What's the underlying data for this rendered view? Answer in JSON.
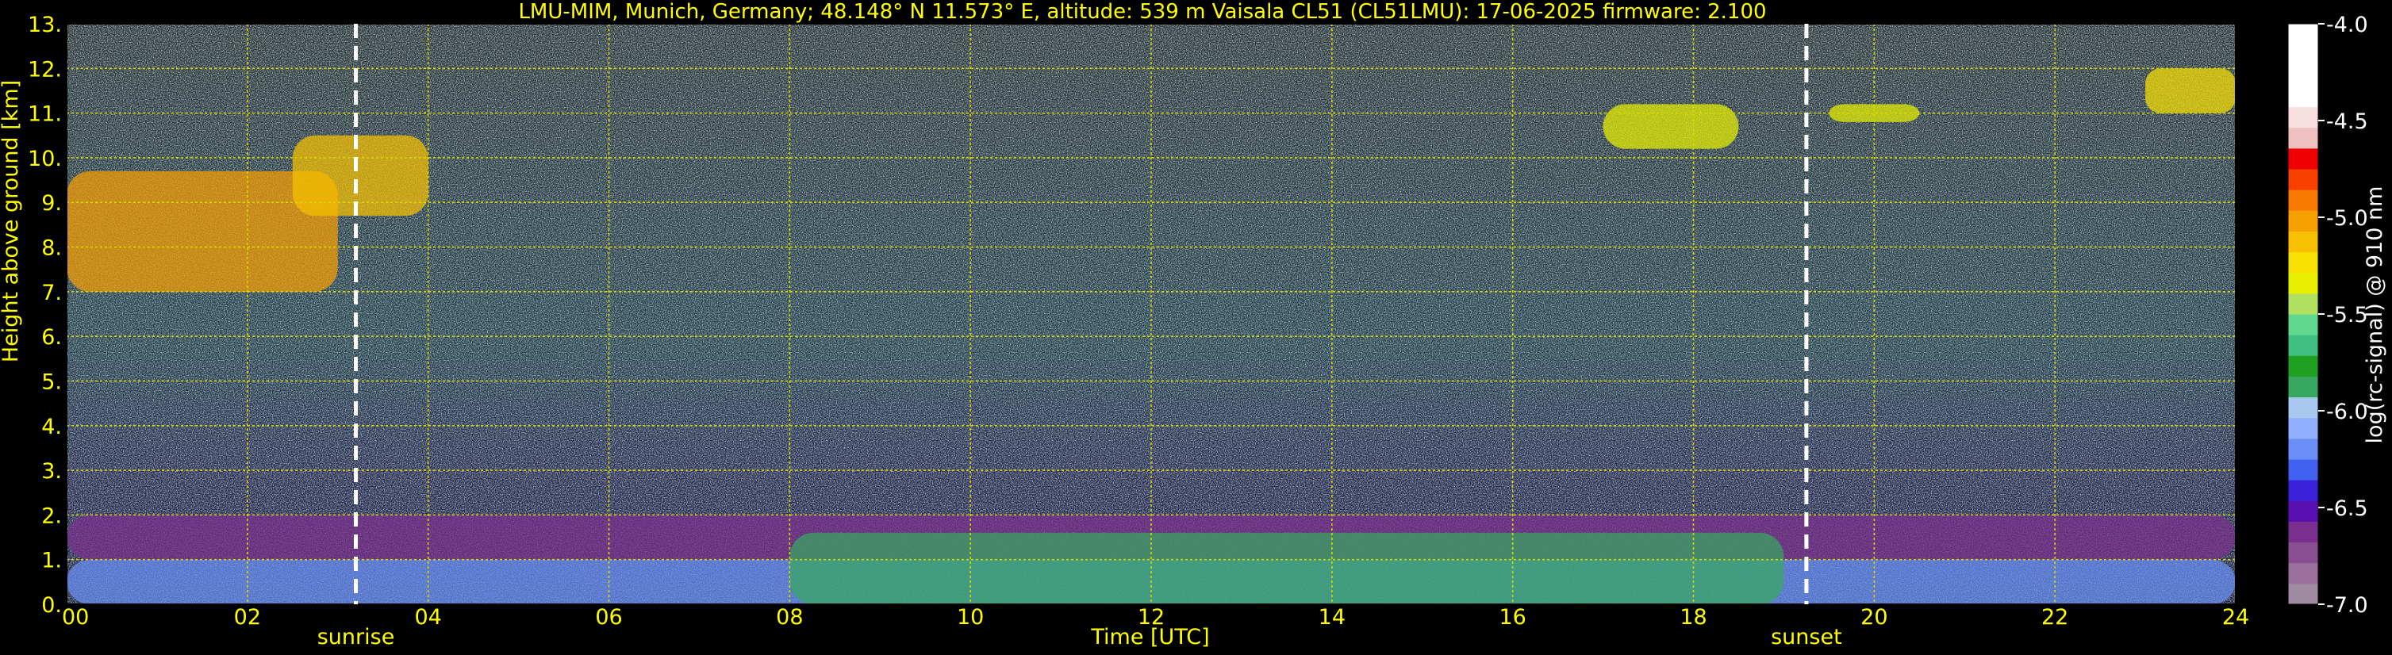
{
  "chart_data": {
    "type": "heatmap",
    "title": "LMU-MIM, Munich, Germany; 48.148° N 11.573° E, altitude: 539 m    Vaisala CL51 (CL51LMU): 17-06-2025    firmware: 2.100",
    "xlabel": "Time [UTC]",
    "ylabel": "Height above ground [km]",
    "colorbar_label": "log(rc-signal) @ 910 nm",
    "xlim": [
      0,
      24
    ],
    "ylim": [
      0,
      13
    ],
    "x_ticks": [
      0,
      2,
      4,
      6,
      8,
      10,
      12,
      14,
      16,
      18,
      20,
      22,
      24
    ],
    "x_tick_labels": [
      "00",
      "02",
      "04",
      "06",
      "08",
      "10",
      "12",
      "14",
      "16",
      "18",
      "20",
      "22",
      "24"
    ],
    "y_ticks": [
      0,
      1,
      2,
      3,
      4,
      5,
      6,
      7,
      8,
      9,
      10,
      11,
      12,
      13
    ],
    "y_tick_labels": [
      "0.",
      "1.",
      "2.",
      "3.",
      "4.",
      "5.",
      "6.",
      "7.",
      "8.",
      "9.",
      "10.",
      "11.",
      "12.",
      "13."
    ],
    "colorbar_range": [
      -7.0,
      -4.0
    ],
    "colorbar_ticks": [
      -7.0,
      -6.5,
      -6.0,
      -5.5,
      -5.0,
      -4.5,
      -4.0
    ],
    "colorbar_tick_labels": [
      "-7.0",
      "-6.5",
      "-6.0",
      "-5.5",
      "-5.0",
      "-4.5",
      "-4.0"
    ],
    "markers": [
      {
        "label": "sunrise",
        "x": 3.2
      },
      {
        "label": "sunset",
        "x": 19.25
      }
    ],
    "grid": true,
    "features": [
      {
        "x": [
          0.0,
          3.0
        ],
        "y": [
          7.0,
          9.7
        ],
        "value": -5.0
      },
      {
        "x": [
          2.5,
          4.0
        ],
        "y": [
          8.7,
          10.5
        ],
        "value": -5.1
      },
      {
        "x": [
          0.0,
          24.0
        ],
        "y": [
          0.0,
          1.0
        ],
        "value": -6.2
      },
      {
        "x": [
          0.0,
          24.0
        ],
        "y": [
          1.0,
          2.0
        ],
        "value": -6.6
      },
      {
        "x": [
          8.0,
          19.0
        ],
        "y": [
          0.0,
          1.6
        ],
        "value": -5.9
      },
      {
        "x": [
          17.0,
          18.5
        ],
        "y": [
          10.2,
          11.2
        ],
        "value": -5.3
      },
      {
        "x": [
          19.5,
          20.5
        ],
        "y": [
          10.8,
          11.2
        ],
        "value": -5.3
      },
      {
        "x": [
          23.0,
          24.0
        ],
        "y": [
          11.0,
          12.0
        ],
        "value": -5.2
      }
    ]
  },
  "colors": {
    "text": "#ffff00",
    "grid": "#d8d800",
    "marker": "#ffffff",
    "background": "#000000"
  }
}
